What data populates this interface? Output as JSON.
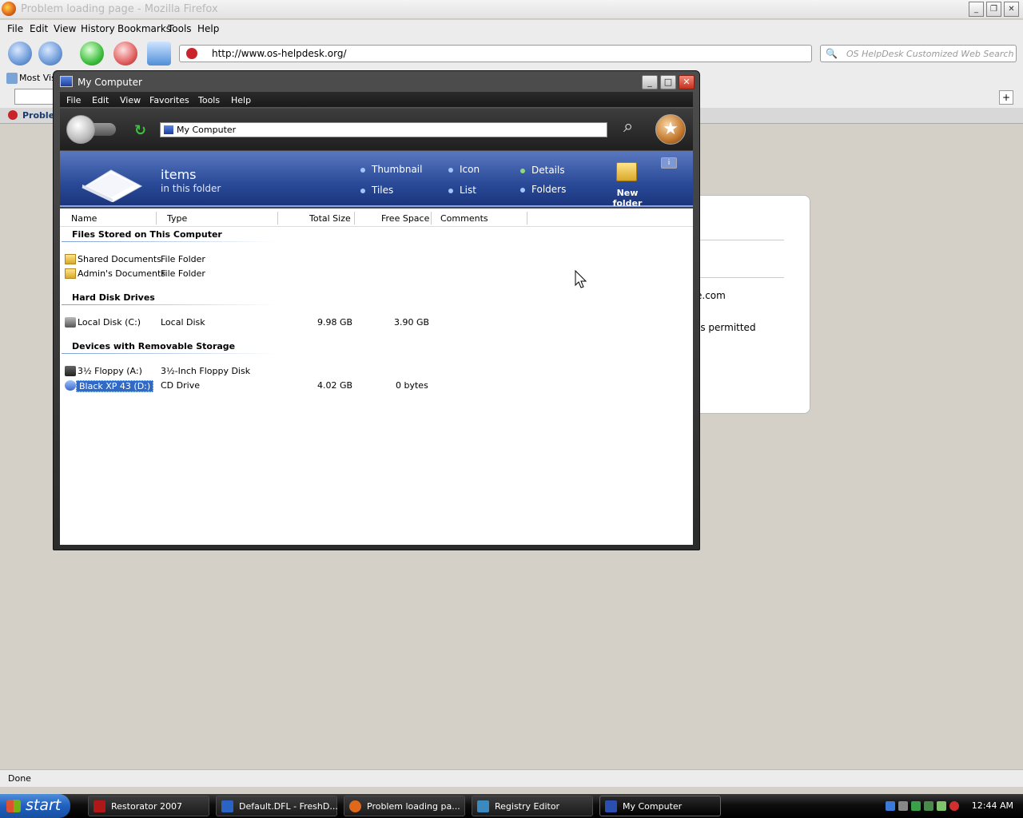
{
  "firefox": {
    "window_title": "Problem loading page - Mozilla Firefox",
    "menu": [
      "File",
      "Edit",
      "View",
      "History",
      "Bookmarks",
      "Tools",
      "Help"
    ],
    "url": "http://www.os-helpdesk.org/",
    "search_placeholder": "OS HelpDesk Customized Web Search",
    "bookmark_label": "Most Visi",
    "tab_label": "Proble",
    "status": "Done",
    "page_fragments": {
      "text1": "e.com",
      "text2": "is permitted"
    }
  },
  "explorer": {
    "title": "My Computer",
    "menu": [
      "File",
      "Edit",
      "View",
      "Favorites",
      "Tools",
      "Help"
    ],
    "address": "My Computer",
    "header": {
      "count_label": "items",
      "sub_label": "in this folder"
    },
    "views": {
      "thumbnail": "Thumbnail",
      "icon": "Icon",
      "details": "Details",
      "tiles": "Tiles",
      "list": "List",
      "folders": "Folders"
    },
    "new_folder_label": "New folder",
    "columns": [
      "Name",
      "Type",
      "Total Size",
      "Free Space",
      "Comments"
    ],
    "groups": [
      {
        "title": "Files Stored on This Computer",
        "items": [
          {
            "name": "Shared Documents",
            "type": "File Folder",
            "total": "",
            "free": "",
            "icon": "folder-icon"
          },
          {
            "name": "Admin's Documents",
            "type": "File Folder",
            "total": "",
            "free": "",
            "icon": "folder-icon"
          }
        ]
      },
      {
        "title": "Hard Disk Drives",
        "items": [
          {
            "name": "Local Disk (C:)",
            "type": "Local Disk",
            "total": "9.98 GB",
            "free": "3.90 GB",
            "icon": "hard-disk-icon"
          }
        ]
      },
      {
        "title": "Devices with Removable Storage",
        "items": [
          {
            "name": "3½ Floppy (A:)",
            "type": "3½-Inch Floppy Disk",
            "total": "",
            "free": "",
            "icon": "floppy-drive-icon"
          },
          {
            "name": "Black XP 43 (D:)",
            "type": "CD Drive",
            "total": "4.02 GB",
            "free": "0 bytes",
            "icon": "cd-drive-icon",
            "selected": true
          }
        ]
      }
    ]
  },
  "taskbar": {
    "start_label": "start",
    "tasks": [
      {
        "label": "Restorator 2007",
        "color": "#b01818"
      },
      {
        "label": "Default.DFL - FreshD...",
        "color": "#2b63c4"
      },
      {
        "label": "Problem loading pa...",
        "color": "#e0681a"
      },
      {
        "label": "Registry Editor",
        "color": "#3a8ac0"
      },
      {
        "label": "My Computer",
        "color": "#2b4fb0",
        "active": true
      }
    ],
    "clock": "12:44 AM"
  }
}
